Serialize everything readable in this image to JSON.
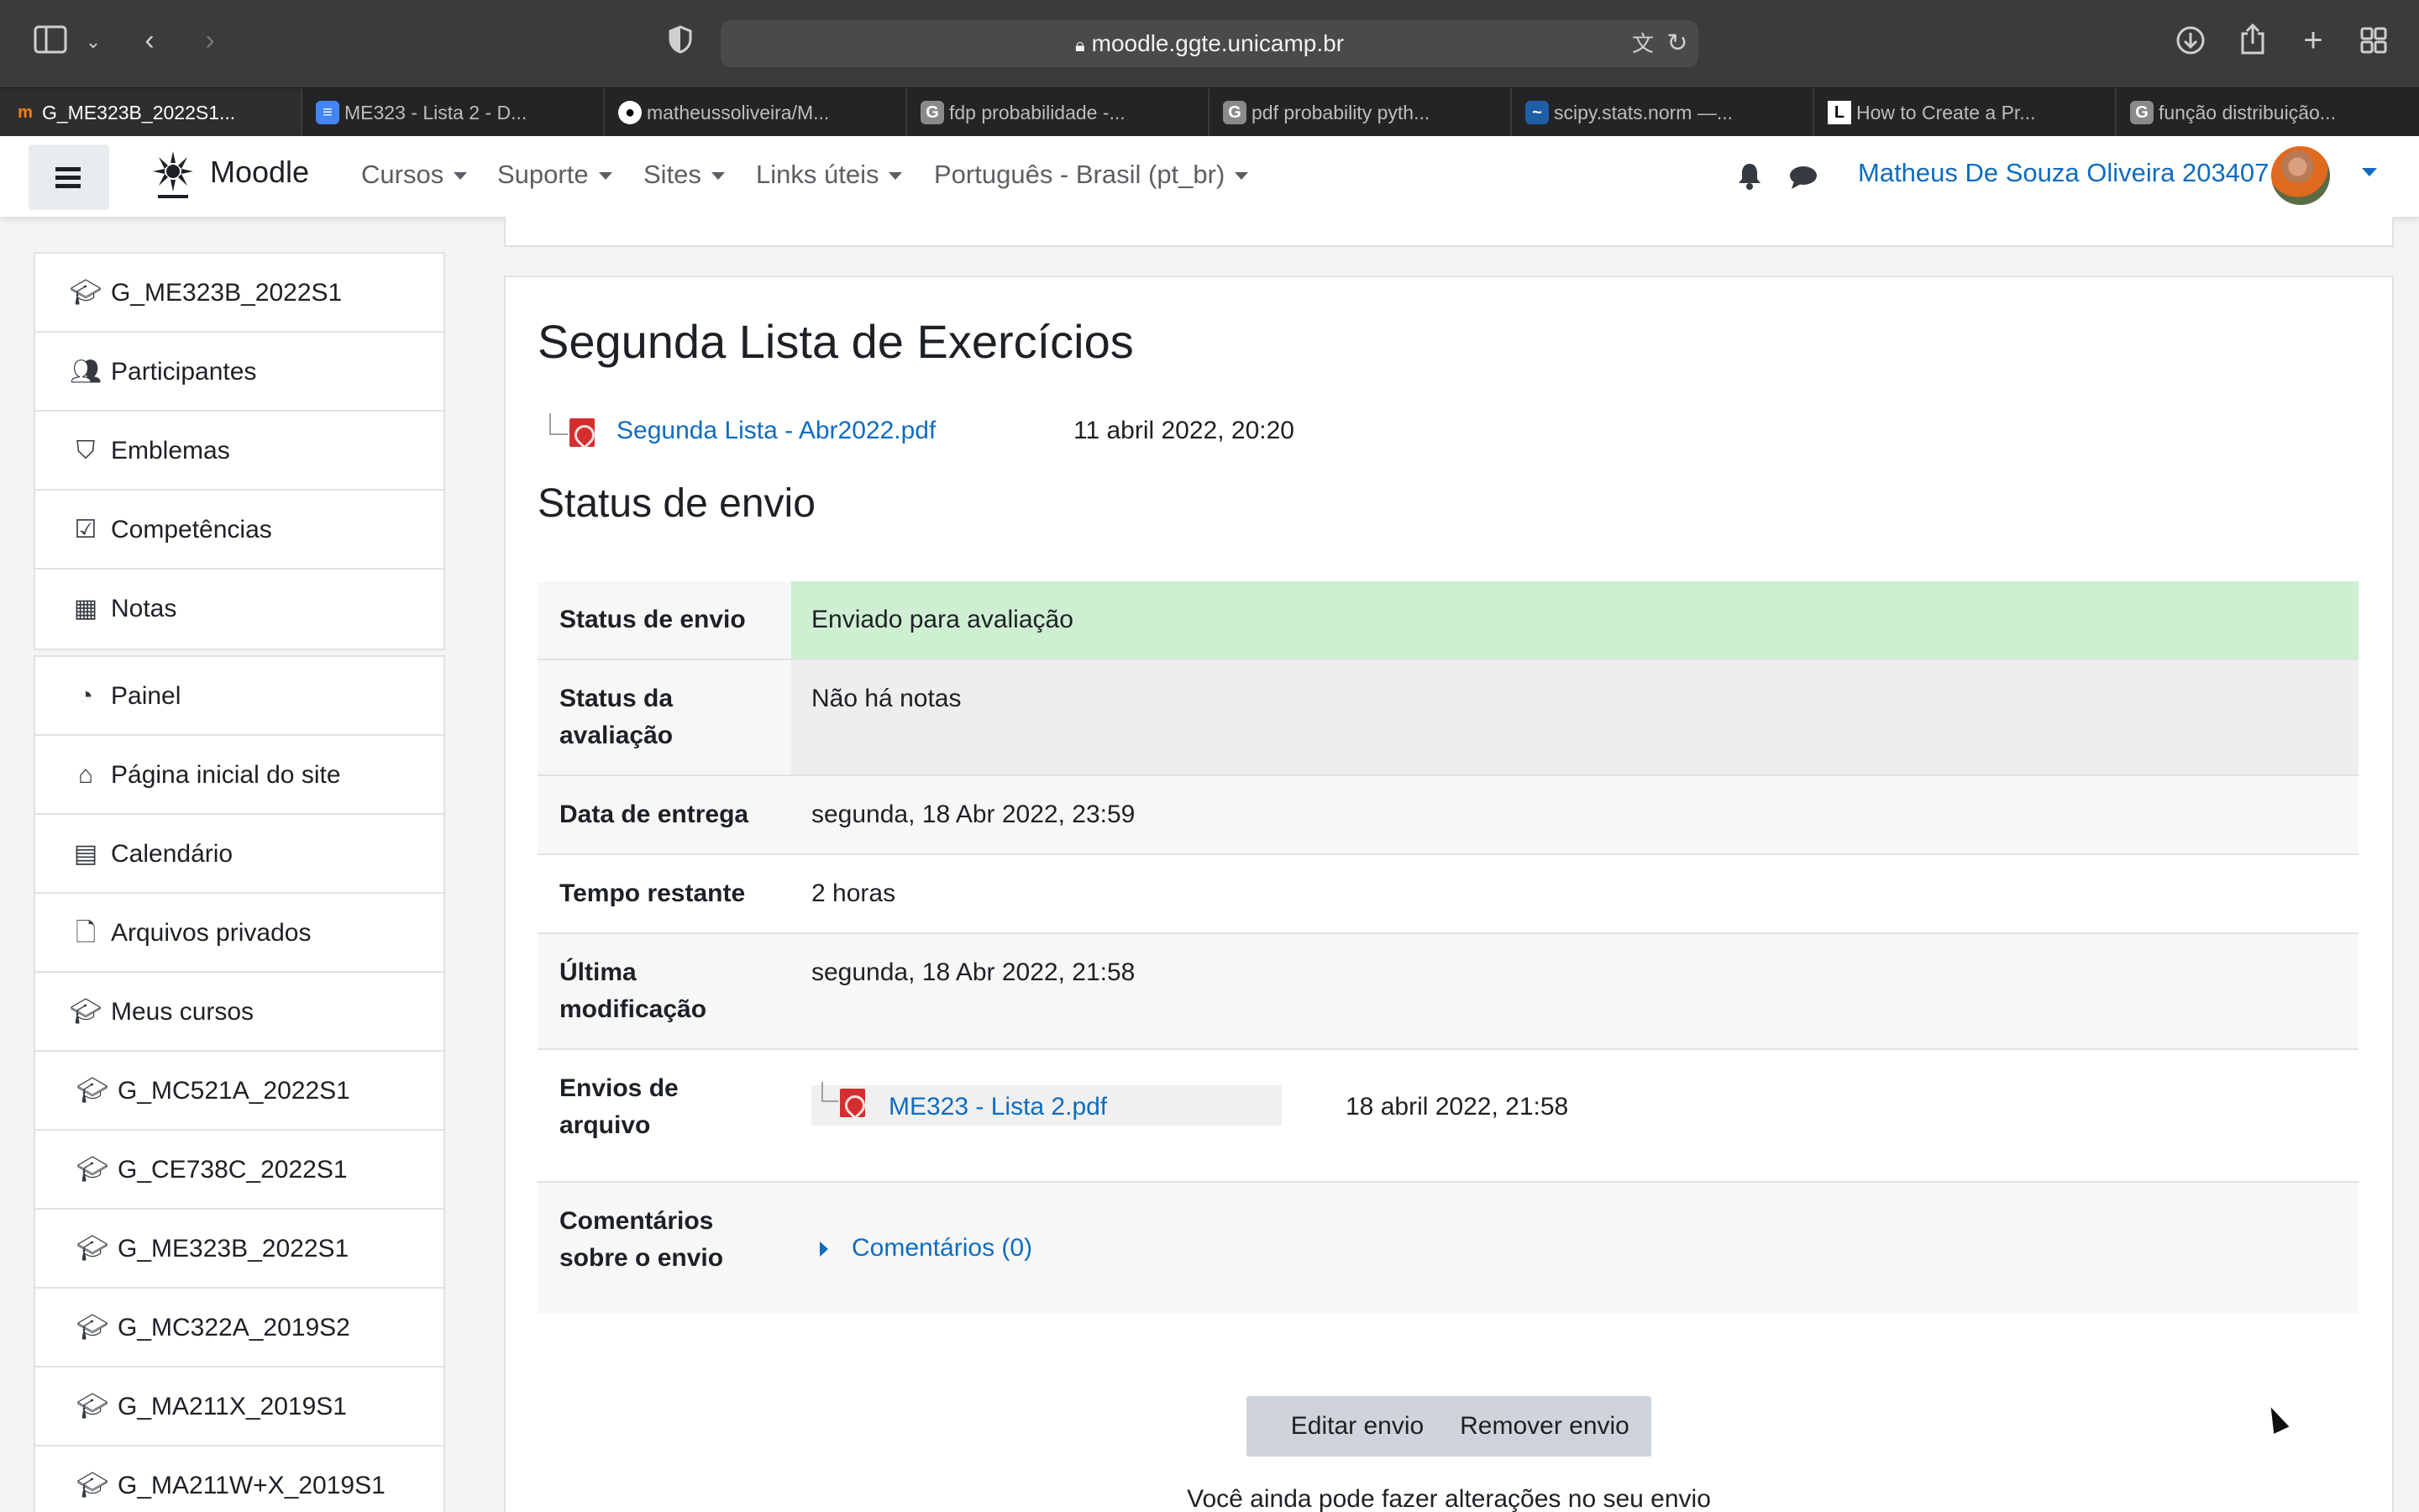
{
  "browser": {
    "url": "moodle.ggte.unicamp.br",
    "tabs": [
      {
        "label": "G_ME323B_2022S1...",
        "icon": "moodle-favicon",
        "active": true
      },
      {
        "label": "ME323 - Lista 2 - D...",
        "icon": "docs-favicon",
        "active": false
      },
      {
        "label": "matheussoliveira/M...",
        "icon": "github-favicon",
        "active": false
      },
      {
        "label": "fdp probabilidade -...",
        "icon": "google-favicon",
        "active": false
      },
      {
        "label": "pdf probability pyth...",
        "icon": "google-favicon",
        "active": false
      },
      {
        "label": "scipy.stats.norm —...",
        "icon": "scipy-favicon",
        "active": false
      },
      {
        "label": "How to Create a Pr...",
        "icon": "l-favicon",
        "active": false
      },
      {
        "label": "função distribuição...",
        "icon": "google-favicon",
        "active": false
      }
    ],
    "tab_letters": {
      "google": "G",
      "l": "L"
    }
  },
  "navbar": {
    "brand": "Moodle",
    "menu": [
      "Cursos",
      "Suporte",
      "Sites",
      "Links úteis",
      "Português - Brasil (pt_br)"
    ],
    "user": "Matheus De Souza Oliveira 203407"
  },
  "sidebar": {
    "course_block": [
      {
        "label": "G_ME323B_2022S1",
        "icon": "graduation-cap-icon"
      },
      {
        "label": "Participantes",
        "icon": "users-icon"
      },
      {
        "label": "Emblemas",
        "icon": "shield-icon"
      },
      {
        "label": "Competências",
        "icon": "check-square-icon"
      },
      {
        "label": "Notas",
        "icon": "table-icon"
      }
    ],
    "site_block": [
      {
        "label": "Painel",
        "icon": "dashboard-icon"
      },
      {
        "label": "Página inicial do site",
        "icon": "home-icon"
      },
      {
        "label": "Calendário",
        "icon": "calendar-icon"
      },
      {
        "label": "Arquivos privados",
        "icon": "file-icon"
      },
      {
        "label": "Meus cursos",
        "icon": "graduation-cap-icon"
      },
      {
        "label": "G_MC521A_2022S1",
        "icon": "graduation-cap-icon"
      },
      {
        "label": "G_CE738C_2022S1",
        "icon": "graduation-cap-icon"
      },
      {
        "label": "G_ME323B_2022S1",
        "icon": "graduation-cap-icon"
      },
      {
        "label": "G_MC322A_2019S2",
        "icon": "graduation-cap-icon"
      },
      {
        "label": "G_MA211X_2019S1",
        "icon": "graduation-cap-icon"
      },
      {
        "label": "G_MA211W+X_2019S1",
        "icon": "graduation-cap-icon"
      }
    ]
  },
  "assignment": {
    "title": "Segunda Lista de Exercícios",
    "attachment": {
      "name": "Segunda Lista - Abr2022.pdf",
      "date": "11 abril 2022, 20:20"
    },
    "status_heading": "Status de envio",
    "rows": {
      "submission_status": {
        "label": "Status de envio",
        "value": "Enviado para avaliação"
      },
      "grading_status": {
        "label": "Status da avaliação",
        "value": "Não há notas"
      },
      "due_date": {
        "label": "Data de entrega",
        "value": "segunda, 18 Abr 2022, 23:59"
      },
      "time_remaining": {
        "label": "Tempo restante",
        "value": "2 horas"
      },
      "last_modified": {
        "label": "Última modificação",
        "value": "segunda, 18 Abr 2022, 21:58"
      },
      "file_submissions": {
        "label": "Envios de arquivo",
        "file": "ME323 - Lista 2.pdf",
        "date": "18 abril 2022, 21:58"
      },
      "comments": {
        "label": "Comentários sobre o envio",
        "link": "Comentários (0)"
      }
    },
    "buttons": {
      "edit": "Editar envio",
      "remove": "Remover envio"
    },
    "footnote": "Você ainda pode fazer alterações no seu envio"
  },
  "colors": {
    "link": "#0f6cbf",
    "status_ok": "#cfefd2",
    "button": "#ced4da"
  }
}
